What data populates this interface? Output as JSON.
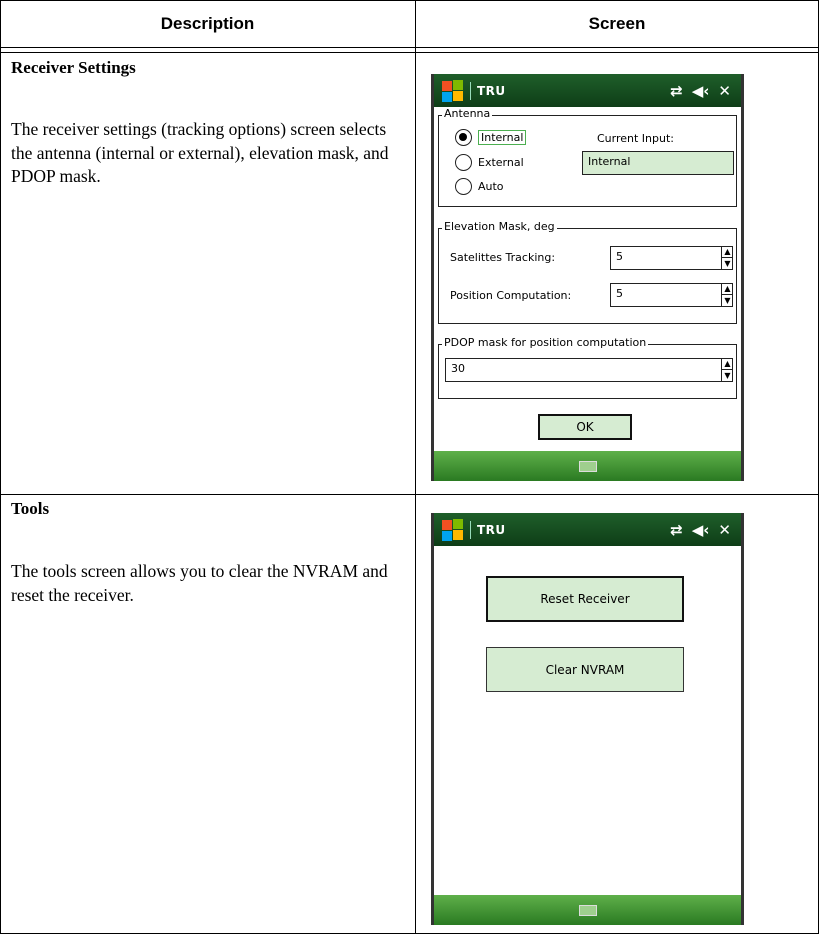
{
  "table": {
    "headers": [
      "Description",
      "Screen"
    ],
    "rows": [
      {
        "title": "Receiver Settings",
        "body": "The receiver settings (tracking options) screen selects the antenna (internal or external), elevation mask, and PDOP mask."
      },
      {
        "title": "Tools",
        "body": "The tools screen allows you to clear the NVRAM and reset the receiver."
      }
    ]
  },
  "screen1": {
    "app_title": "TRU",
    "antenna_group": "Antenna",
    "radio_options": [
      "Internal",
      "External",
      "Auto"
    ],
    "selected_option": "Internal",
    "current_input_label": "Current Input:",
    "current_input_value": "Internal",
    "elevation_group": "Elevation Mask, deg",
    "sat_tracking_label": "Satelittes Tracking:",
    "sat_tracking_value": "5",
    "pos_comp_label": "Position Computation:",
    "pos_comp_value": "5",
    "pdop_group": "PDOP mask for position computation",
    "pdop_value": "30",
    "ok_label": "OK"
  },
  "screen2": {
    "app_title": "TRU",
    "reset_label": "Reset Receiver",
    "clear_label": "Clear NVRAM"
  },
  "icons": {
    "connectivity": "⇄",
    "volume": "◀‹",
    "close": "✕"
  }
}
